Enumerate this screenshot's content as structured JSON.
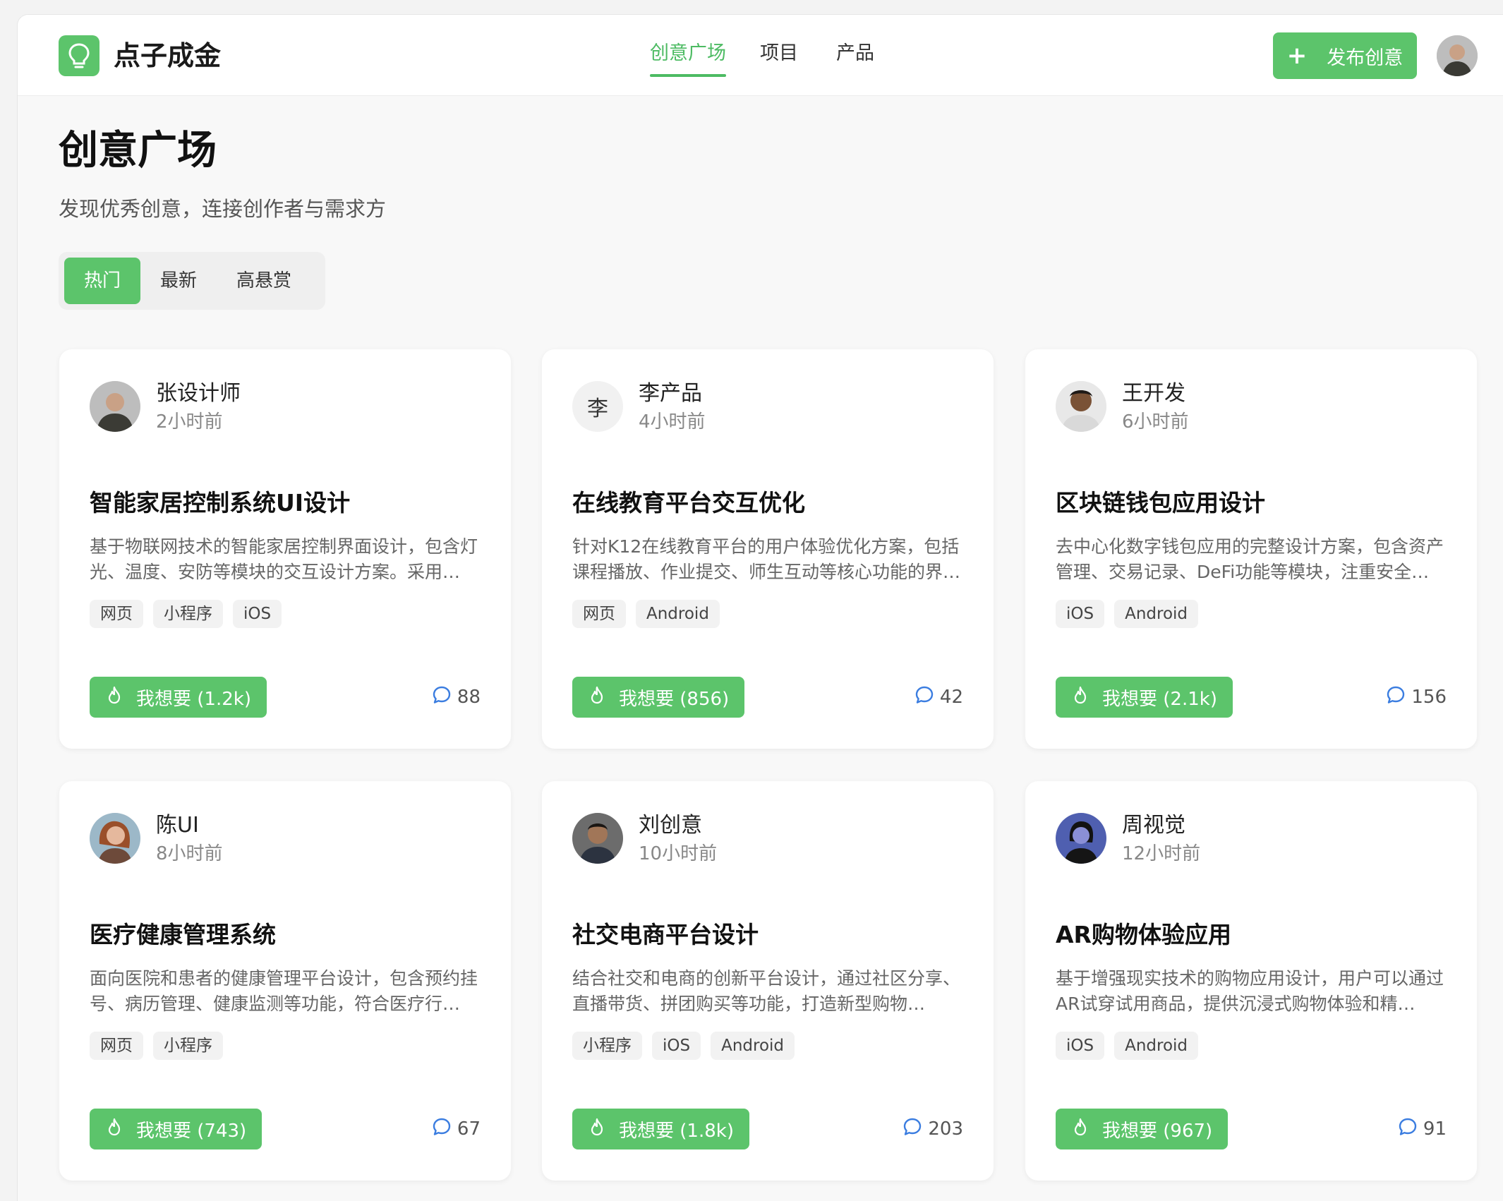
{
  "brand": {
    "name": "点子成金",
    "logo_icon": "lightbulb-icon",
    "accent": "#5cc46b"
  },
  "nav": [
    {
      "label": "创意广场",
      "active": true
    },
    {
      "label": "项目",
      "active": false
    },
    {
      "label": "产品",
      "active": false
    }
  ],
  "header": {
    "publish_label": "发布创意",
    "publish_icon": "plus-icon"
  },
  "page": {
    "title": "创意广场",
    "subtitle": "发现优秀创意，连接创作者与需求方"
  },
  "tabs": [
    {
      "label": "热门",
      "active": true
    },
    {
      "label": "最新",
      "active": false
    },
    {
      "label": "高悬赏",
      "active": false
    }
  ],
  "cards": [
    {
      "author": "张设计师",
      "time": "2小时前",
      "avatar_initial": "",
      "title": "智能家居控制系统UI设计",
      "desc": "基于物联网技术的智能家居控制界面设计，包含灯光、温度、安防等模块的交互设计方案。采用…",
      "tags": [
        "网页",
        "小程序",
        "iOS"
      ],
      "want_label": "我想要 (1.2k)",
      "comments": "88"
    },
    {
      "author": "李产品",
      "time": "4小时前",
      "avatar_initial": "李",
      "title": "在线教育平台交互优化",
      "desc": "针对K12在线教育平台的用户体验优化方案，包括课程播放、作业提交、师生互动等核心功能的界…",
      "tags": [
        "网页",
        "Android"
      ],
      "want_label": "我想要 (856)",
      "comments": "42"
    },
    {
      "author": "王开发",
      "time": "6小时前",
      "avatar_initial": "",
      "title": "区块链钱包应用设计",
      "desc": "去中心化数字钱包应用的完整设计方案，包含资产管理、交易记录、DeFi功能等模块，注重安全…",
      "tags": [
        "iOS",
        "Android"
      ],
      "want_label": "我想要 (2.1k)",
      "comments": "156"
    },
    {
      "author": "陈UI",
      "time": "8小时前",
      "avatar_initial": "",
      "title": "医疗健康管理系统",
      "desc": "面向医院和患者的健康管理平台设计，包含预约挂号、病历管理、健康监测等功能，符合医疗行…",
      "tags": [
        "网页",
        "小程序"
      ],
      "want_label": "我想要 (743)",
      "comments": "67"
    },
    {
      "author": "刘创意",
      "time": "10小时前",
      "avatar_initial": "",
      "title": "社交电商平台设计",
      "desc": "结合社交和电商的创新平台设计，通过社区分享、直播带货、拼团购买等功能，打造新型购物…",
      "tags": [
        "小程序",
        "iOS",
        "Android"
      ],
      "want_label": "我想要 (1.8k)",
      "comments": "203"
    },
    {
      "author": "周视觉",
      "time": "12小时前",
      "avatar_initial": "",
      "title": "AR购物体验应用",
      "desc": "基于增强现实技术的购物应用设计，用户可以通过AR试穿试用商品，提供沉浸式购物体验和精…",
      "tags": [
        "iOS",
        "Android"
      ],
      "want_label": "我想要 (967)",
      "comments": "91"
    }
  ]
}
